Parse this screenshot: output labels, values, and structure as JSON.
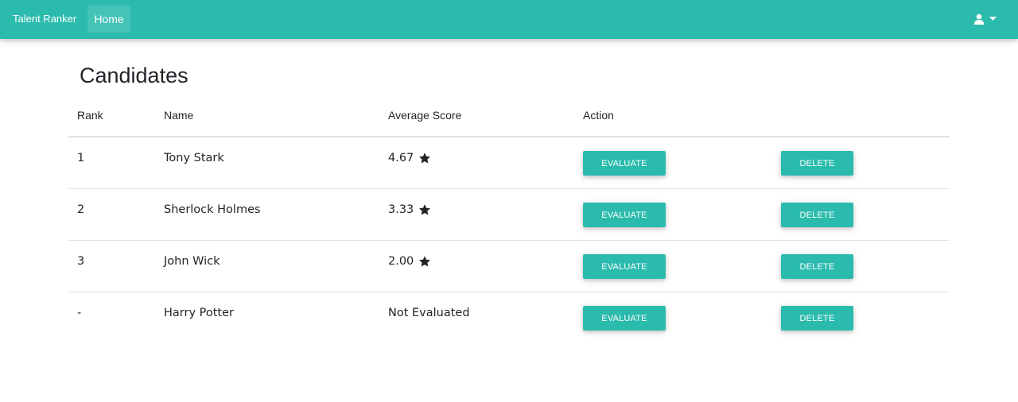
{
  "colors": {
    "accent": "#2bbbad",
    "text": "#212529",
    "star": "#212529"
  },
  "navbar": {
    "brand": "Talent Ranker",
    "home_label": "Home",
    "user_icon": "user-icon",
    "dropdown_icon": "caret-down-icon"
  },
  "page": {
    "title": "Candidates"
  },
  "table": {
    "headers": {
      "rank": "Rank",
      "name": "Name",
      "score": "Average Score",
      "action": "Action"
    },
    "rows": [
      {
        "rank": "1",
        "name": "Tony Stark",
        "score": "4.67",
        "rated": true,
        "evaluate": "EVALUATE",
        "delete": "DELETE"
      },
      {
        "rank": "2",
        "name": "Sherlock Holmes",
        "score": "3.33",
        "rated": true,
        "evaluate": "EVALUATE",
        "delete": "DELETE"
      },
      {
        "rank": "3",
        "name": "John Wick",
        "score": "2.00",
        "rated": true,
        "evaluate": "EVALUATE",
        "delete": "DELETE"
      },
      {
        "rank": "-",
        "name": "Harry Potter",
        "score": "Not Evaluated",
        "rated": false,
        "evaluate": "EVALUATE",
        "delete": "DELETE"
      }
    ]
  }
}
